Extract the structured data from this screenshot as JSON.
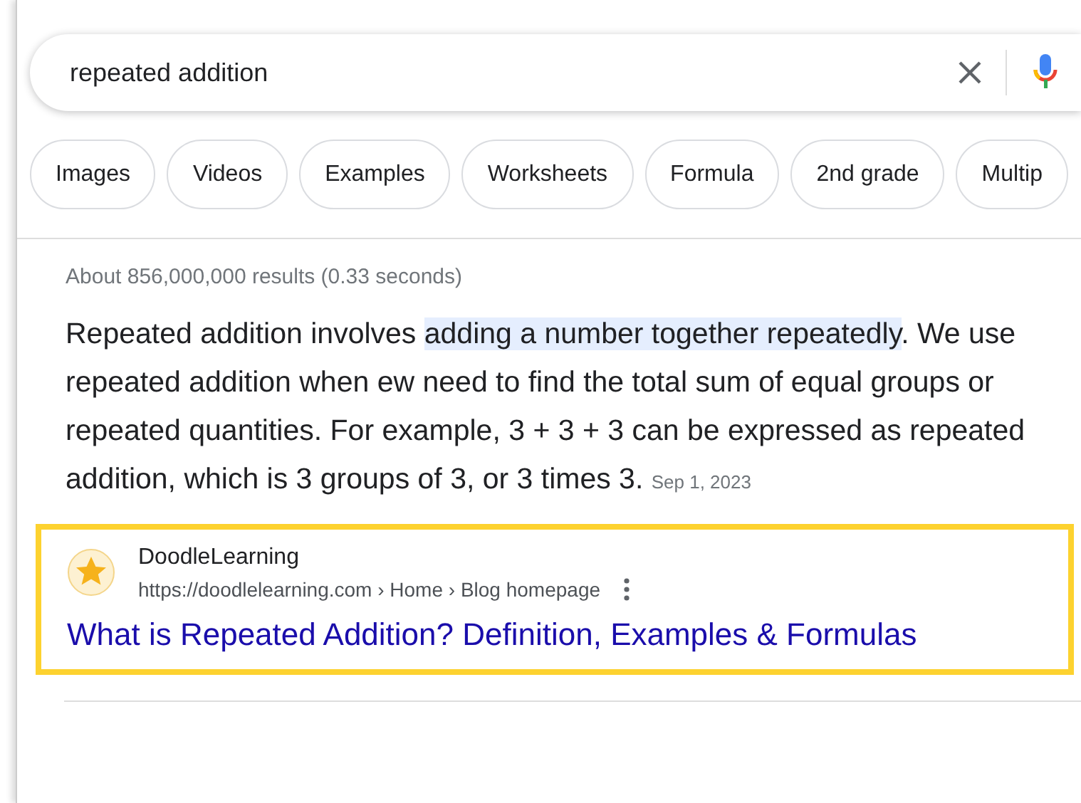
{
  "search": {
    "value": "repeated addition"
  },
  "chips": [
    {
      "label": "Images"
    },
    {
      "label": "Videos"
    },
    {
      "label": "Examples"
    },
    {
      "label": "Worksheets"
    },
    {
      "label": "Formula"
    },
    {
      "label": "2nd grade"
    },
    {
      "label": "Multip"
    }
  ],
  "result_stats": "About 856,000,000 results (0.33 seconds)",
  "snippet": {
    "parts": [
      {
        "text": "Repeated addition involves ",
        "highlighted": false
      },
      {
        "text": "adding a number together repeatedly",
        "highlighted": true
      },
      {
        "text": ". We use repeated addition when ew need to find the total sum of equal groups or repeated quantities. For example, 3 + 3 + 3 can be expressed as repeated addition, which is 3 groups of 3, or 3 times 3.",
        "highlighted": false
      }
    ],
    "date": "Sep 1, 2023"
  },
  "result": {
    "site": "DoodleLearning",
    "url": "https://doodlelearning.com › Home › Blog homepage",
    "title": "What is Repeated Addition? Definition, Examples & Formulas",
    "outlined": true
  }
}
